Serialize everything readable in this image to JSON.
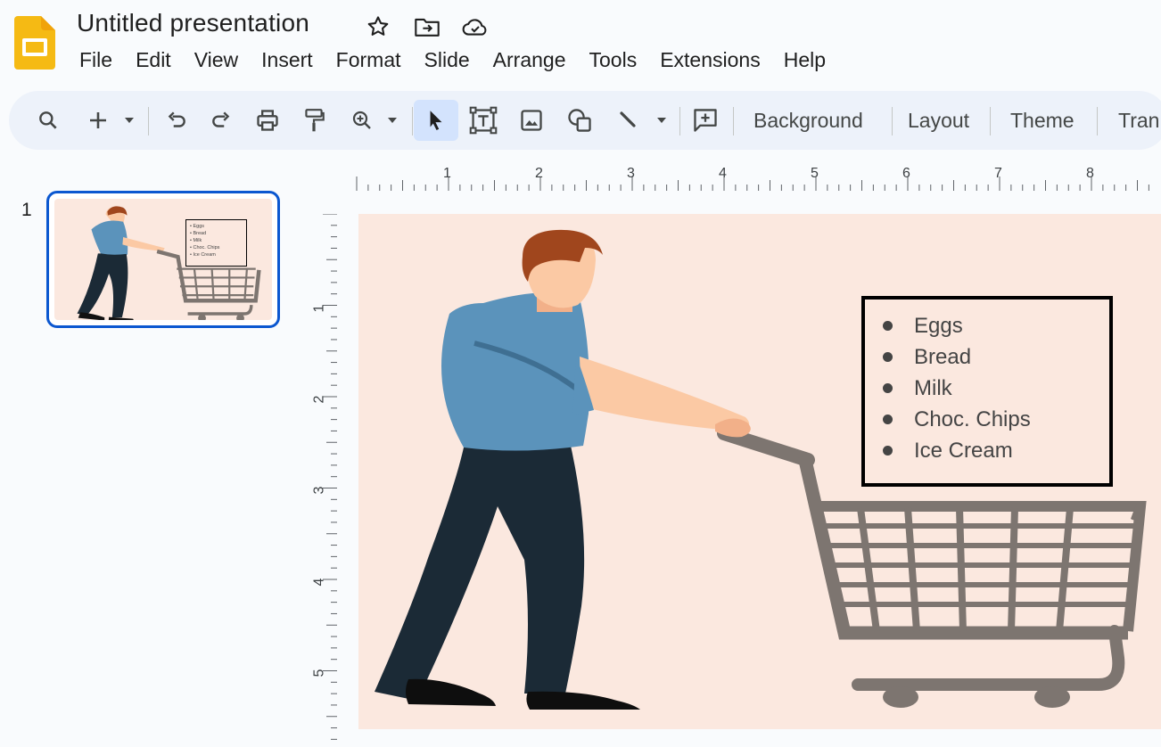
{
  "app": {
    "title": "Untitled presentation",
    "icons": [
      "slides-logo-icon",
      "star-icon",
      "move-to-folder-icon",
      "cloud-saved-icon"
    ],
    "accent": "#0b57d0",
    "logo_color": "#f5ba14"
  },
  "menu": [
    "File",
    "Edit",
    "View",
    "Insert",
    "Format",
    "Slide",
    "Arrange",
    "Tools",
    "Extensions",
    "Help"
  ],
  "toolbar": {
    "icons": [
      "search-icon",
      "new-slide-icon",
      "undo-icon",
      "redo-icon",
      "print-icon",
      "paint-format-icon",
      "zoom-icon",
      "select-icon",
      "text-box-icon",
      "image-icon",
      "shape-icon",
      "line-icon",
      "comment-icon"
    ],
    "background_label": "Background",
    "layout_label": "Layout",
    "theme_label": "Theme",
    "transition_label": "Tran"
  },
  "ruler": {
    "horizontal": [
      "1",
      "2",
      "3",
      "4",
      "5",
      "6",
      "7",
      "8"
    ],
    "vertical": [
      "1",
      "2",
      "3",
      "4",
      "5"
    ]
  },
  "filmstrip": {
    "slide_number": "1"
  },
  "slide": {
    "background": "#fbe8df",
    "shopping_list": [
      "Eggs",
      "Bread",
      "Milk",
      "Choc. Chips",
      "Ice Cream"
    ]
  }
}
